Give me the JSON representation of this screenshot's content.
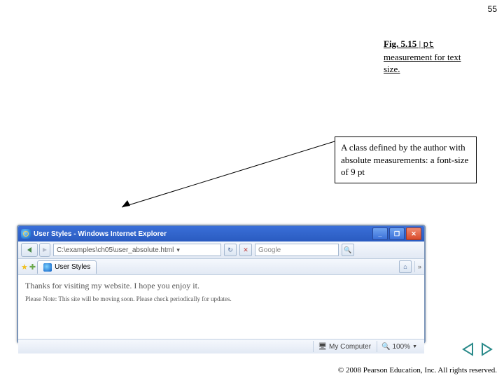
{
  "page_number": "55",
  "caption": {
    "fig": "Fig. 5.15",
    "pipe": " | ",
    "code": "pt",
    "rest1": " measurement for text size.",
    "full": "Fig. 5.15 | pt measurement for text size."
  },
  "callout": "A class defined by the author with absolute measurements: a font-size of 9 pt",
  "browser": {
    "title": "User Styles - Windows Internet Explorer",
    "url": "C:\\examples\\ch05\\user_absolute.html",
    "search_placeholder": "Google",
    "tab_label": "User Styles",
    "content_line1": "Thanks for visiting my website. I hope you enjoy it.",
    "content_line2": "Please Note: This site will be moving soon. Please check periodically for updates.",
    "status_zone": "My Computer",
    "status_zoom": "100%"
  },
  "footer": {
    "copyright": "© 2008 Pearson Education, Inc.  All rights reserved."
  }
}
